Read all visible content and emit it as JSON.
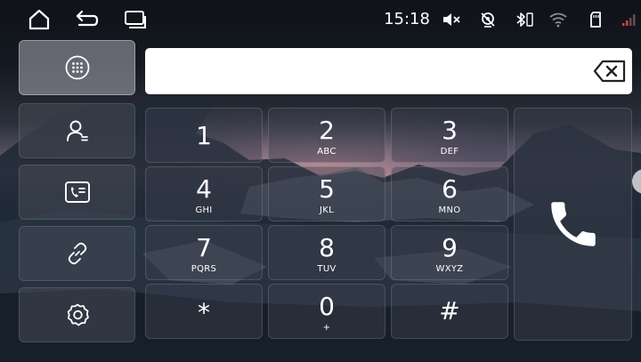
{
  "status_bar": {
    "time": "15:18",
    "icons": [
      "home-icon",
      "back-icon",
      "recent-apps-icon",
      "mute-icon",
      "location-off-icon",
      "bluetooth-phone-icon",
      "wifi-icon",
      "sd-card-icon",
      "signal-icon"
    ]
  },
  "sidebar": {
    "items": [
      {
        "icon": "dialpad-icon",
        "active": true
      },
      {
        "icon": "contacts-icon",
        "active": false
      },
      {
        "icon": "call-log-icon",
        "active": false
      },
      {
        "icon": "link-icon",
        "active": false
      },
      {
        "icon": "settings-icon",
        "active": false
      }
    ]
  },
  "dial_display": {
    "value": "",
    "backspace_icon": "backspace-icon"
  },
  "keypad": {
    "keys": [
      {
        "digit": "1",
        "letters": ""
      },
      {
        "digit": "2",
        "letters": "ABC"
      },
      {
        "digit": "3",
        "letters": "DEF"
      },
      {
        "digit": "4",
        "letters": "GHI"
      },
      {
        "digit": "5",
        "letters": "JKL"
      },
      {
        "digit": "6",
        "letters": "MNO"
      },
      {
        "digit": "7",
        "letters": "PQRS"
      },
      {
        "digit": "8",
        "letters": "TUV"
      },
      {
        "digit": "9",
        "letters": "WXYZ"
      },
      {
        "digit": "*",
        "letters": ""
      },
      {
        "digit": "0",
        "letters": "+"
      },
      {
        "digit": "#",
        "letters": ""
      }
    ],
    "call_icon": "phone-call-icon"
  },
  "colors": {
    "text": "#ffffff",
    "display_bg": "#ffffff",
    "signal_accent": "#e0413a"
  }
}
